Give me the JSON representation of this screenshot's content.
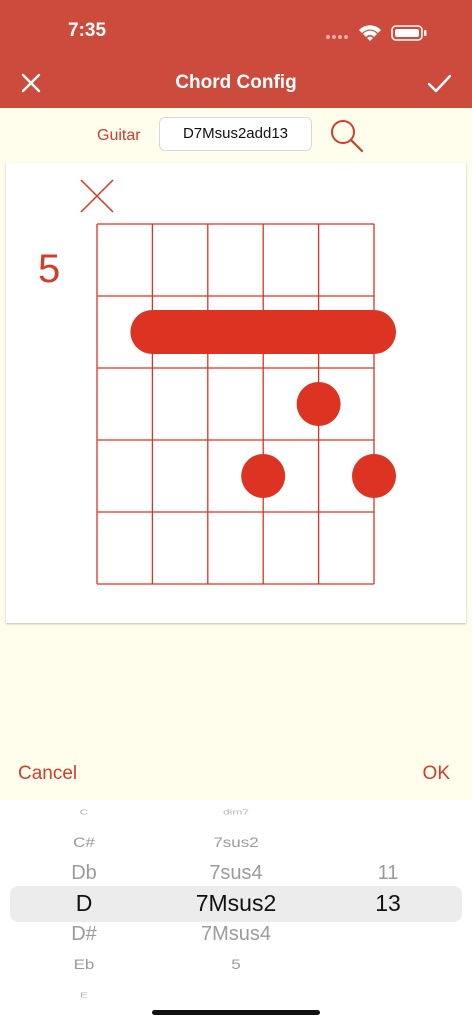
{
  "status": {
    "time": "7:35"
  },
  "header": {
    "title": "Chord Config"
  },
  "search": {
    "instrument": "Guitar",
    "chord_value": "D7Msus2add13"
  },
  "diagram": {
    "start_fret": "5",
    "muted_strings": [
      1
    ],
    "barre": {
      "fret": 2,
      "from_string": 2,
      "to_string": 6
    },
    "dots": [
      {
        "string": 5,
        "fret": 3
      },
      {
        "string": 4,
        "fret": 4
      },
      {
        "string": 6,
        "fret": 4
      }
    ],
    "accent_color": "#dd3322"
  },
  "picker": {
    "cancel_label": "Cancel",
    "ok_label": "OK",
    "root_column": [
      "C",
      "C#",
      "Db",
      "D",
      "D#",
      "Eb",
      "E"
    ],
    "root_selected": 3,
    "type_column": [
      "dim7",
      "7sus2",
      "7sus4",
      "7Msus2",
      "7Msus4",
      "5"
    ],
    "type_selected": 3,
    "extension_column": [
      "11",
      "13"
    ],
    "extension_selected": 1
  }
}
